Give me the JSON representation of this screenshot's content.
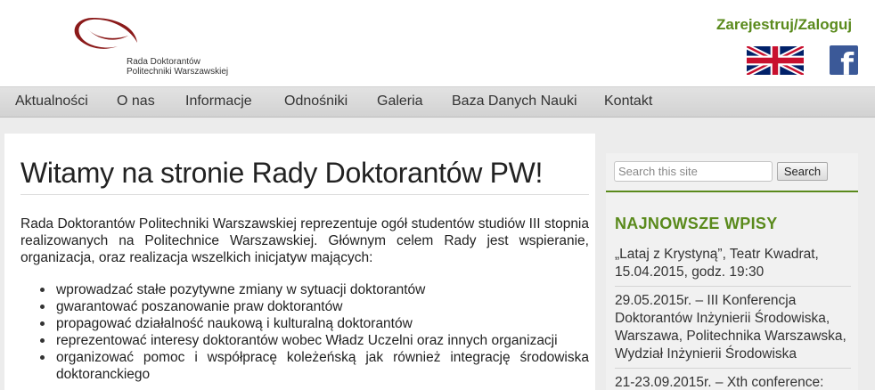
{
  "header": {
    "logo_line1": "Rada Doktorantów",
    "logo_line2": "Politechniki Warszawskiej",
    "auth_link": "Zarejestruj/Zaloguj",
    "logo_color": "#8b1a1a",
    "accent_color": "#5a8a1c",
    "icons": [
      "uk-flag-icon",
      "facebook-icon"
    ],
    "facebook_glyph": "f"
  },
  "nav": {
    "items": [
      "Aktualności",
      "O nas",
      "Informacje",
      "Odnośniki",
      "Galeria",
      "Baza Danych Nauki",
      "Kontakt"
    ]
  },
  "main": {
    "title": "Witamy na stronie Rady Doktorantów PW!",
    "intro": "Rada Doktorantów Politechniki Warszawskiej reprezentuje ogół studentów studiów III stopnia realizowanych na Politechnice Warszawskiej. Głównym celem Rady jest wspieranie, organizacja, oraz realizacja wszelkich inicjatyw mających:",
    "bullets": [
      "wprowadzać stałe pozytywne zmiany w sytuacji doktorantów",
      "gwarantować poszanowanie praw doktorantów",
      "propagować działalność naukową i kulturalną doktorantów",
      "reprezentować interesy doktorantów wobec Władz Uczelni oraz innych organizacji",
      "organizować pomoc i współpracę koleżeńską jak również integrację środowiska doktoranckiego"
    ]
  },
  "sidebar": {
    "search_placeholder": "Search this site",
    "search_button": "Search",
    "widget_title": "NAJNOWSZE WPISY",
    "posts": [
      "„Lataj z Krystyną”, Teatr Kwadrat, 15.04.2015, godz. 19:30",
      "29.05.2015r. – III Konferencja Doktorantów Inżynierii Środowiska, Warszawa, Politechnika Warszawska, Wydział Inżynierii Środowiska",
      "21-23.09.2015r. – Xth conference:"
    ]
  }
}
